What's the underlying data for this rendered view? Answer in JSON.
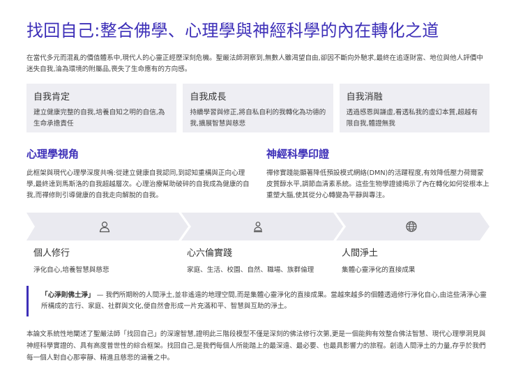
{
  "title": "找回自己:整合佛學、心理學與神經科學的內在轉化之道",
  "intro": "在當代多元而混亂的價值體系中,現代人的心靈正經歷深刻危機。聖嚴法師洞察到,無數人雖渴望自由,卻因不斷向外馳求,最終在追逐財富、地位與他人評價中迷失自我,淪為環境的附屬品,喪失了生命應有的方向感。",
  "cards": [
    {
      "title": "自我肯定",
      "desc": "建立健康完整的自我,培養自知之明的自信,為生命承擔責任"
    },
    {
      "title": "自我成長",
      "desc": "持續學習與修正,將自私自利的我轉化為功德的我,擴展智慧與慈悲"
    },
    {
      "title": "自我消融",
      "desc": "透過感恩與謙虛,看透私我的虛幻本質,超越有限自我,體證無我"
    }
  ],
  "psychology": {
    "title": "心理學視角",
    "body": "此框架與現代心理學深度共鳴:從建立健康自我認同,到認知重構與正向心理學,最終達到馬斯洛的自我超越層次。心理治療幫助破碎的自我成為健康的自我,而禪修則引導健康的自我走向解脫的自我。"
  },
  "neuroscience": {
    "title": "神經科學印證",
    "body": "禪修實踐能顯著降低預設模式網絡(DMN)的活躍程度,有效降低壓力荷爾蒙皮質醇水平,調節血清素系統。這些生物學證據揭示了內在轉化如何從根本上重塑大腦,使其從分心轉變為平靜與專注。"
  },
  "steps": [
    {
      "icon": "person-icon",
      "title": "個人修行",
      "desc": "淨化自心,培養智慧與慈悲"
    },
    {
      "icon": "family-icon",
      "title": "心六倫實踐",
      "desc": "家庭、生活、校園、自然、職場、族群倫理"
    },
    {
      "icon": "globe-icon",
      "title": "人間淨土",
      "desc": "集體心靈淨化的直接成果"
    }
  ],
  "quote": {
    "strong": "「心淨則佛土淨」",
    "text": " — 我們所期盼的人間淨土,並非遙遠的地理空間,而是集體心靈淨化的直接成果。當越來越多的個體透過修行淨化自心,由這些清淨心靈所構成的言行、家庭、社群與文化,便自然會形成一片充滿和平、智慧與互助的淨土。"
  },
  "conclusion": "本論文系統性地闡述了聖嚴法師「找回自己」的深邃智慧,證明此三階段模型不僅是深刻的佛法修行次第,更是一個能夠有效整合佛法智慧、現代心理學洞見與神經科學實證的、具有高度普世性的綜合框架。找回自己,是我們每個人所能踏上的最深遠、最必要、也最具影響力的旅程。創造人間淨土的力量,存乎於我們每一個人對自心那寧靜、精進且慈悲的涵養之中。",
  "colors": {
    "accent": "#3d2fb8",
    "card_bg": "#eeeef3",
    "step_bg": "#eaeaf0"
  }
}
